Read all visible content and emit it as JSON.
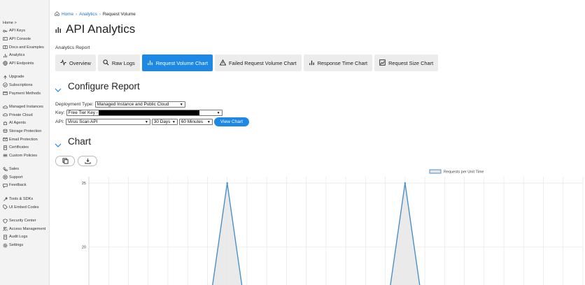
{
  "sidebar": {
    "home": "Home >",
    "groups": [
      [
        {
          "label": "API Keys",
          "icon": "key-icon"
        },
        {
          "label": "API Console",
          "icon": "console-icon"
        },
        {
          "label": "Docs and Examples",
          "icon": "book-icon"
        },
        {
          "label": "Analytics",
          "icon": "bar-chart-icon"
        },
        {
          "label": "API Endpoints",
          "icon": "globe-icon"
        }
      ],
      [
        {
          "label": "Upgrade",
          "icon": "upgrade-icon"
        },
        {
          "label": "Subscriptions",
          "icon": "subscriptions-icon"
        },
        {
          "label": "Payment Methods",
          "icon": "card-icon"
        }
      ],
      [
        {
          "label": "Managed Instances",
          "icon": "cloud-icon"
        },
        {
          "label": "Private Cloud",
          "icon": "private-cloud-icon"
        },
        {
          "label": "AI Agents",
          "icon": "robot-icon"
        },
        {
          "label": "Storage Protection",
          "icon": "storage-icon"
        },
        {
          "label": "Email Protection",
          "icon": "mail-icon"
        },
        {
          "label": "Certificates",
          "icon": "certificate-icon"
        },
        {
          "label": "Custom Policies",
          "icon": "policies-icon"
        }
      ],
      [
        {
          "label": "Sales",
          "icon": "phone-icon"
        },
        {
          "label": "Support",
          "icon": "support-icon"
        },
        {
          "label": "Feedback",
          "icon": "feedback-icon"
        }
      ],
      [
        {
          "label": "Tools & SDKs",
          "icon": "tools-icon"
        },
        {
          "label": "UI Embed Codes",
          "icon": "tag-icon"
        }
      ],
      [
        {
          "label": "Security Center",
          "icon": "shield-icon"
        },
        {
          "label": "Access Management",
          "icon": "users-icon"
        },
        {
          "label": "Audit Logs",
          "icon": "log-icon"
        },
        {
          "label": "Settings",
          "icon": "gear-icon"
        }
      ]
    ]
  },
  "breadcrumb": {
    "home": "Home",
    "analytics": "Analytics",
    "current": "Request Volume",
    "sep": "›"
  },
  "page": {
    "title": "API Analytics",
    "report_label": "Analytics Report"
  },
  "tabs": [
    {
      "label": "Overview",
      "icon": "pulse-icon",
      "active": false
    },
    {
      "label": "Raw Logs",
      "icon": "search-icon",
      "active": false
    },
    {
      "label": "Request Volume Chart",
      "icon": "bar-chart-icon",
      "active": true
    },
    {
      "label": "Failed Request Volume Chart",
      "icon": "warning-icon",
      "active": false
    },
    {
      "label": "Response Time Chart",
      "icon": "bar-chart-icon",
      "active": false
    },
    {
      "label": "Request Size Chart",
      "icon": "area-chart-icon",
      "active": false
    }
  ],
  "configure": {
    "heading": "Configure Report",
    "deployment_label": "Deployment Type:",
    "deployment_value": "Managed Instance and Public Cloud",
    "key_label": "Key:",
    "key_value": "Free Tier Key -",
    "api_label": "API:",
    "api_value": "Virus Scan API",
    "range_value": "30 Days",
    "interval_value": "60 Minutes",
    "view_button": "View Chart"
  },
  "chart_section": {
    "heading": "Chart"
  },
  "chart_data": {
    "type": "area",
    "legend": [
      "Requests per Unit Time"
    ],
    "legend_position": "top-center",
    "y_ticks": [
      25,
      20
    ],
    "ylim_visible": [
      17,
      25.5
    ],
    "grid": true,
    "series": [
      {
        "name": "Requests per Unit Time",
        "peaks_at_category_index": [
          7,
          16
        ],
        "peak_value": 25
      }
    ],
    "category_count": 26,
    "colors": {
      "line": "#4a90c8",
      "fill": "#e6e6e6"
    }
  }
}
